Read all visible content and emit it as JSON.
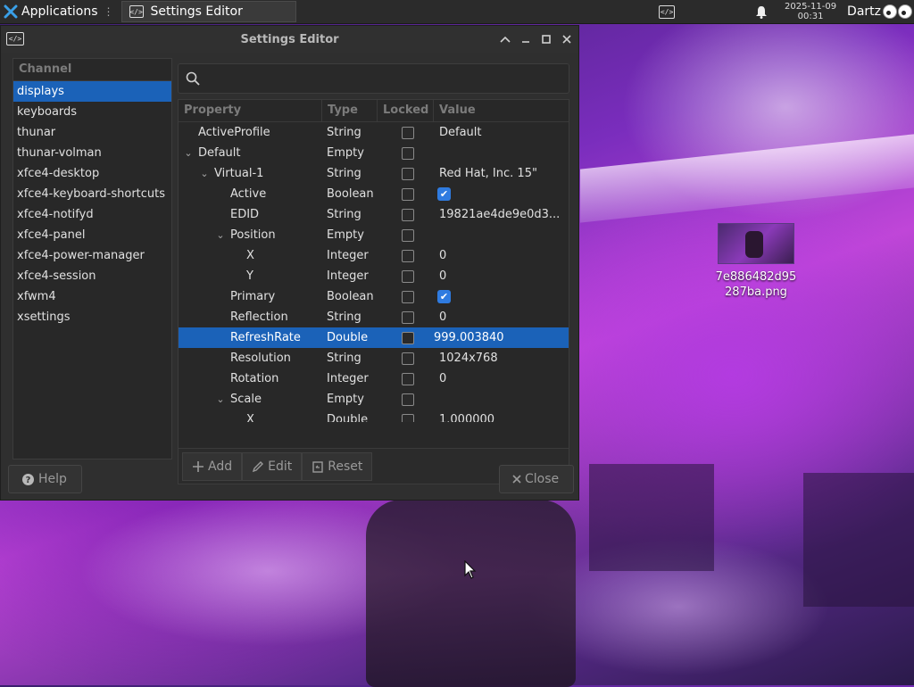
{
  "panel": {
    "applications_label": "Applications",
    "task_button_label": "Settings Editor",
    "clock_date": "2025-11-09",
    "clock_time": "00:31",
    "user_name": "Dartz"
  },
  "window": {
    "title": "Settings Editor",
    "channel_header": "Channel",
    "channels": [
      "displays",
      "keyboards",
      "thunar",
      "thunar-volman",
      "xfce4-desktop",
      "xfce4-keyboard-shortcuts",
      "xfce4-notifyd",
      "xfce4-panel",
      "xfce4-power-manager",
      "xfce4-session",
      "xfwm4",
      "xsettings"
    ],
    "selected_channel": "displays",
    "search_placeholder": "",
    "columns": {
      "property": "Property",
      "type": "Type",
      "locked": "Locked",
      "value": "Value"
    },
    "properties": [
      {
        "name": "ActiveProfile",
        "type": "String",
        "locked": false,
        "value": "Default",
        "depth": 0,
        "expander": ""
      },
      {
        "name": "Default",
        "type": "Empty",
        "locked": false,
        "value": "",
        "depth": 0,
        "expander": "⌄"
      },
      {
        "name": "Virtual-1",
        "type": "String",
        "locked": false,
        "value": "Red Hat, Inc. 15\"",
        "depth": 1,
        "expander": "⌄"
      },
      {
        "name": "Active",
        "type": "Boolean",
        "locked": false,
        "value": "true",
        "depth": 2,
        "expander": ""
      },
      {
        "name": "EDID",
        "type": "String",
        "locked": false,
        "value": "19821ae4de9e0d3...",
        "depth": 2,
        "expander": ""
      },
      {
        "name": "Position",
        "type": "Empty",
        "locked": false,
        "value": "",
        "depth": 2,
        "expander": "⌄"
      },
      {
        "name": "X",
        "type": "Integer",
        "locked": false,
        "value": "0",
        "depth": 3,
        "expander": ""
      },
      {
        "name": "Y",
        "type": "Integer",
        "locked": false,
        "value": "0",
        "depth": 3,
        "expander": ""
      },
      {
        "name": "Primary",
        "type": "Boolean",
        "locked": false,
        "value": "true",
        "depth": 2,
        "expander": ""
      },
      {
        "name": "Reflection",
        "type": "String",
        "locked": false,
        "value": "0",
        "depth": 2,
        "expander": ""
      },
      {
        "name": "RefreshRate",
        "type": "Double",
        "locked": false,
        "value": "999.003840",
        "depth": 2,
        "expander": "",
        "selected": true
      },
      {
        "name": "Resolution",
        "type": "String",
        "locked": false,
        "value": "1024x768",
        "depth": 2,
        "expander": ""
      },
      {
        "name": "Rotation",
        "type": "Integer",
        "locked": false,
        "value": "0",
        "depth": 2,
        "expander": ""
      },
      {
        "name": "Scale",
        "type": "Empty",
        "locked": false,
        "value": "",
        "depth": 2,
        "expander": "⌄"
      },
      {
        "name": "X",
        "type": "Double",
        "locked": false,
        "value": "1.000000",
        "depth": 3,
        "expander": ""
      }
    ],
    "buttons": {
      "add": "Add",
      "edit": "Edit",
      "reset": "Reset",
      "help": "Help",
      "close": "Close"
    }
  },
  "desktop": {
    "file_icon_label": "7e886482d95287ba.png"
  },
  "colors": {
    "selection": "#1b62b8",
    "checkbox_checked": "#2f7be0",
    "panel_bg": "#2b2b2b",
    "window_bg": "#2f2f2f"
  }
}
